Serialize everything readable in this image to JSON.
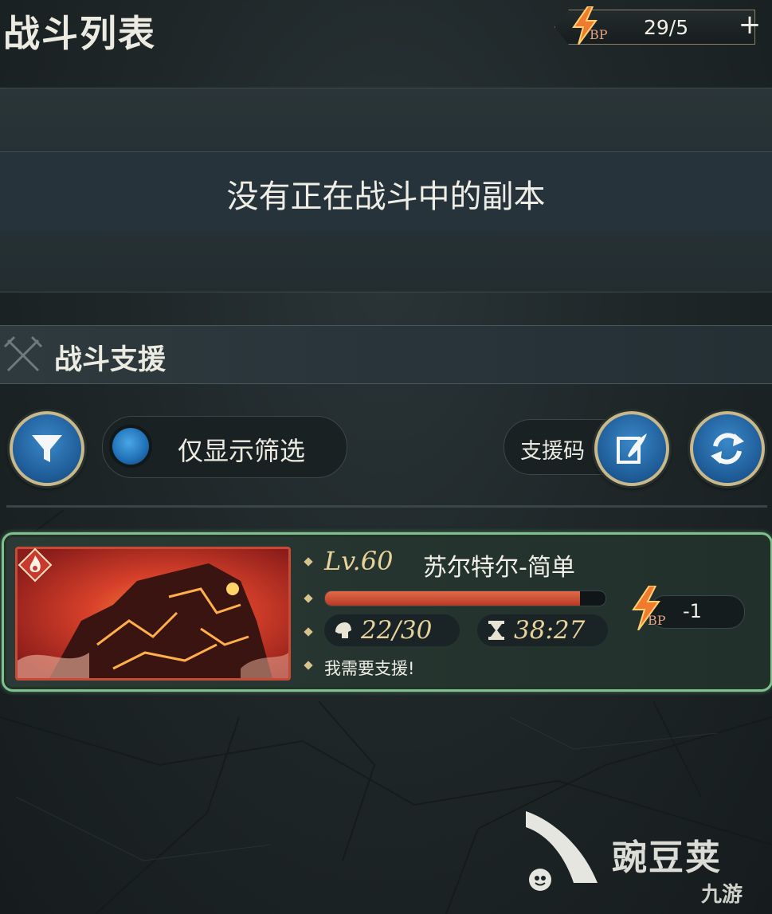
{
  "header": {
    "title": "战斗列表",
    "bp": {
      "label": "BP",
      "value": "29/5",
      "add_icon": "plus-icon",
      "icon": "lightning-bolt-icon"
    }
  },
  "empty_state": {
    "message": "没有正在战斗中的副本"
  },
  "support_section": {
    "title": "战斗支援",
    "icon": "crossed-swords-icon",
    "filter_button_icon": "filter-funnel-icon",
    "filter_toggle_label": "仅显示筛选",
    "support_code_label": "支援码",
    "support_code_icon": "quill-note-icon",
    "refresh_icon": "refresh-arrows-icon"
  },
  "battles": [
    {
      "level": "Lv.60",
      "boss_name": "苏尔特尔-简单",
      "hp_fraction": 0.91,
      "participants": "22/30",
      "time_left": "38:27",
      "message": "我需要支援!",
      "cost_label": "BP",
      "cost_value": "-1",
      "element_icon": "fire-element-icon",
      "participants_icon": "helmet-icon",
      "timer_icon": "hourglass-icon"
    }
  ],
  "watermark": {
    "text": "豌豆荚",
    "sub": "九游"
  },
  "colors": {
    "accent_blue": "#2a74b5",
    "card_border": "#7fc28f",
    "gold": "#e8d39a",
    "hp_red": "#c9482f"
  }
}
